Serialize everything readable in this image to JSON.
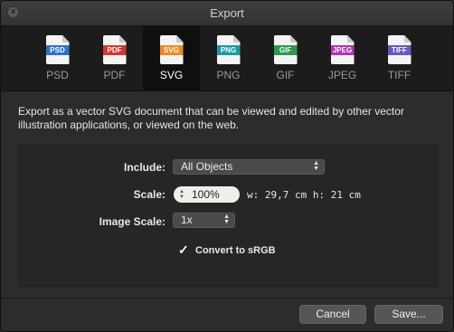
{
  "window": {
    "title": "Export"
  },
  "formats": [
    {
      "label": "PSD",
      "badge": "PSD",
      "color": "#2f74c8",
      "icon": "psd-file-icon"
    },
    {
      "label": "PDF",
      "badge": "PDF",
      "color": "#d5372f",
      "icon": "pdf-file-icon"
    },
    {
      "label": "SVG",
      "badge": "SVG",
      "color": "#ef8a1f",
      "icon": "svg-file-icon"
    },
    {
      "label": "PNG",
      "badge": "PNG",
      "color": "#1a9aa6",
      "icon": "png-file-icon"
    },
    {
      "label": "GIF",
      "badge": "GIF",
      "color": "#2c9a4f",
      "icon": "gif-file-icon"
    },
    {
      "label": "JPEG",
      "badge": "JPEG",
      "color": "#b136b4",
      "icon": "jpeg-file-icon"
    },
    {
      "label": "TIFF",
      "badge": "TIFF",
      "color": "#6a55c6",
      "icon": "tiff-file-icon"
    }
  ],
  "active_format": "SVG",
  "description": "Export as a vector SVG document that can be viewed and edited by other vector illustration applications, or viewed on the web.",
  "options": {
    "include_label": "Include:",
    "include_value": "All Objects",
    "scale_label": "Scale:",
    "scale_value": "100%",
    "dimensions": "w: 29,7 cm h: 21 cm",
    "image_scale_label": "Image Scale:",
    "image_scale_value": "1x",
    "convert_label": "Convert to sRGB",
    "convert_checked": true
  },
  "buttons": {
    "cancel": "Cancel",
    "save": "Save..."
  }
}
